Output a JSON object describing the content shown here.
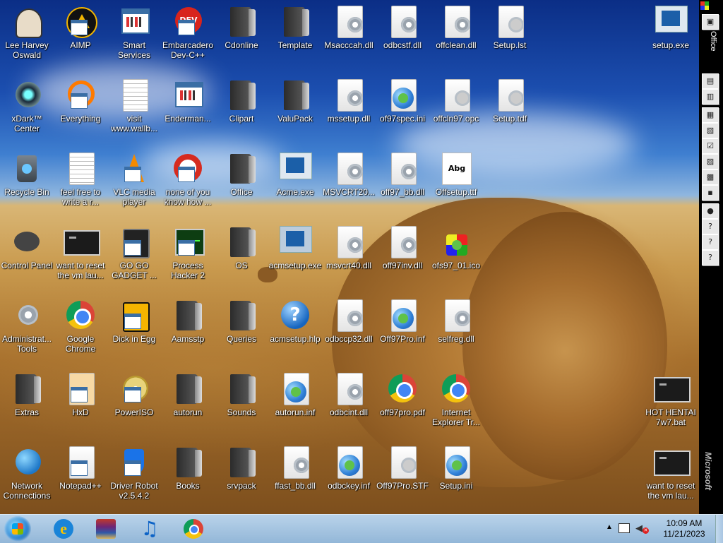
{
  "office_bar": {
    "title": "Office",
    "brand": "Microsoft"
  },
  "taskbar": {
    "pinned": [
      {
        "name": "internet-explorer",
        "icon": "internet-explorer-icon"
      },
      {
        "name": "winrar",
        "icon": "winrar-icon"
      },
      {
        "name": "music-player",
        "icon": "music-note-icon"
      },
      {
        "name": "google-chrome",
        "icon": "chrome-icon"
      }
    ],
    "clock_time": "10:09 AM",
    "clock_date": "11/21/2023"
  },
  "desktop_icons": [
    {
      "label": "Lee Harvey Oswald",
      "icon": "avatar-icon"
    },
    {
      "label": "AIMP",
      "icon": "aimp-icon"
    },
    {
      "label": "Smart Services",
      "icon": "app-shortcut-icon"
    },
    {
      "label": "Embarcadero Dev-C++",
      "icon": "devcpp-icon"
    },
    {
      "label": "Cdonline",
      "icon": "folder-icon"
    },
    {
      "label": "Template",
      "icon": "folder-icon"
    },
    {
      "label": "Msacccah.dll",
      "icon": "dll-gear-icon"
    },
    {
      "label": "odbcstf.dll",
      "icon": "dll-gear-icon"
    },
    {
      "label": "offclean.dll",
      "icon": "dll-gear-icon"
    },
    {
      "label": "Setup.lst",
      "icon": "settings-file-icon"
    },
    {
      "label": "setup.exe",
      "icon": "setup-exe-icon"
    },
    {
      "label": "xDark™ Center",
      "icon": "xdark-icon"
    },
    {
      "label": "Everything",
      "icon": "everything-search-icon"
    },
    {
      "label": "visit www.wallb...",
      "icon": "text-document-icon"
    },
    {
      "label": "Enderman...",
      "icon": "app-shortcut-icon"
    },
    {
      "label": "Clipart",
      "icon": "folder-icon"
    },
    {
      "label": "ValuPack",
      "icon": "folder-icon"
    },
    {
      "label": "mssetup.dll",
      "icon": "dll-gear-icon"
    },
    {
      "label": "of97spec.ini",
      "icon": "config-file-icon"
    },
    {
      "label": "offcln97.opc",
      "icon": "settings-file-icon"
    },
    {
      "label": "Setup.tdf",
      "icon": "settings-file-icon"
    },
    {
      "label": "Recycle Bin",
      "icon": "recycle-bin-icon"
    },
    {
      "label": "feel free to write a r...",
      "icon": "text-document-icon"
    },
    {
      "label": "VLC media player",
      "icon": "vlc-icon"
    },
    {
      "label": "none of you know how ...",
      "icon": "red-circle-icon"
    },
    {
      "label": "Office",
      "icon": "folder-icon"
    },
    {
      "label": "Acme.exe",
      "icon": "setup-exe-icon"
    },
    {
      "label": "MSVCRT20...",
      "icon": "dll-gear-icon"
    },
    {
      "label": "off97_bb.dll",
      "icon": "dll-gear-icon"
    },
    {
      "label": "Offsetup.ttf",
      "icon": "font-file-icon",
      "glyph": "Abg"
    },
    {
      "label": "Control Panel",
      "icon": "control-panel-icon"
    },
    {
      "label": "want to reset the vm lau...",
      "icon": "terminal-icon"
    },
    {
      "label": "GO GO GADGET ...",
      "icon": "gadget-icon"
    },
    {
      "label": "Process Hacker 2",
      "icon": "process-hacker-icon"
    },
    {
      "label": "OS",
      "icon": "folder-icon"
    },
    {
      "label": "acmsetup.exe",
      "icon": "computer-setup-icon"
    },
    {
      "label": "msvcrt40.dll",
      "icon": "dll-gear-icon"
    },
    {
      "label": "off97inv.dll",
      "icon": "dll-gear-icon"
    },
    {
      "label": "ofs97_01.ico",
      "icon": "puzzle-icon"
    },
    {
      "label": "Administrat... Tools",
      "icon": "admin-tools-icon"
    },
    {
      "label": "Google Chrome",
      "icon": "chrome-icon"
    },
    {
      "label": "Dick in Egg",
      "icon": "egg-app-icon"
    },
    {
      "label": "Aamsstp",
      "icon": "folder-icon"
    },
    {
      "label": "Queries",
      "icon": "folder-icon"
    },
    {
      "label": "acmsetup.hlp",
      "icon": "help-icon",
      "glyph": "?"
    },
    {
      "label": "odbccp32.dll",
      "icon": "dll-gear-icon"
    },
    {
      "label": "Off97Pro.inf",
      "icon": "config-file-icon"
    },
    {
      "label": "selfreg.dll",
      "icon": "dll-gear-icon"
    },
    {
      "label": "Extras",
      "icon": "folder-icon"
    },
    {
      "label": "HxD",
      "icon": "hxd-icon"
    },
    {
      "label": "PowerISO",
      "icon": "poweriso-icon"
    },
    {
      "label": "autorun",
      "icon": "folder-icon"
    },
    {
      "label": "Sounds",
      "icon": "folder-icon"
    },
    {
      "label": "autorun.inf",
      "icon": "config-file-icon"
    },
    {
      "label": "odbcint.dll",
      "icon": "dll-gear-icon"
    },
    {
      "label": "off97pro.pdf",
      "icon": "chrome-icon"
    },
    {
      "label": "Internet Explorer Tr...",
      "icon": "chrome-icon"
    },
    {
      "label": "HOT HENTAI 7w7.bat",
      "icon": "terminal-icon"
    },
    {
      "label": "Network Connections",
      "icon": "network-icon"
    },
    {
      "label": "Notepad++",
      "icon": "notepad-plus-icon"
    },
    {
      "label": "Driver Robot v2.5.4.2",
      "icon": "driver-robot-icon"
    },
    {
      "label": "Books",
      "icon": "folder-icon"
    },
    {
      "label": "srvpack",
      "icon": "folder-icon"
    },
    {
      "label": "ffast_bb.dll",
      "icon": "dll-gear-icon"
    },
    {
      "label": "odbckey.inf",
      "icon": "config-file-icon"
    },
    {
      "label": "Off97Pro.STF",
      "icon": "settings-file-icon"
    },
    {
      "label": "Setup.ini",
      "icon": "config-file-icon"
    },
    {
      "label": "want to reset the vm lau...",
      "icon": "terminal-icon"
    }
  ]
}
